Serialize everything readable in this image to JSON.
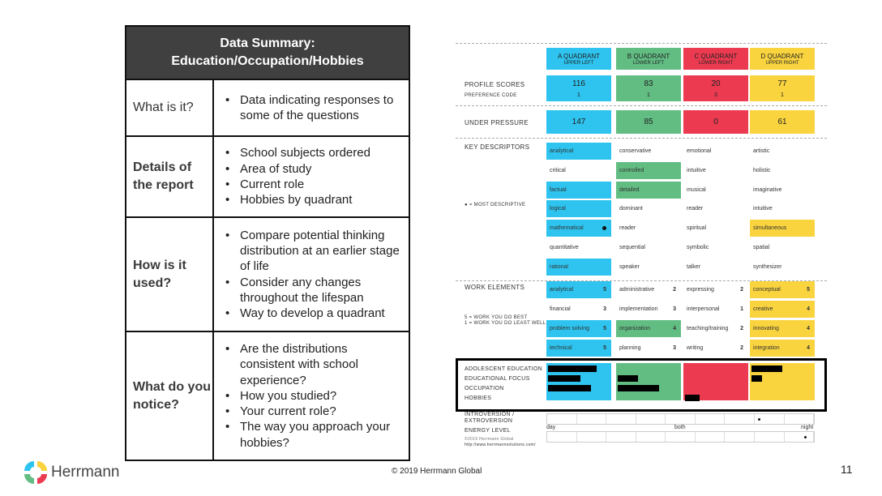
{
  "summary": {
    "title_line1": "Data Summary:",
    "title_line2": "Education/Occupation/Hobbies",
    "rows": [
      {
        "label": "What is it?",
        "bullets": [
          "Data indicating responses to some of the questions"
        ]
      },
      {
        "label": "Details of the report",
        "bullets": [
          "School subjects ordered",
          "Area of study",
          "Current role",
          "Hobbies by quadrant"
        ]
      },
      {
        "label": "How is it used?",
        "bullets": [
          "Compare potential  thinking distribution at an earlier stage of life",
          "Consider any changes throughout the lifespan",
          "Way to develop a quadrant"
        ]
      },
      {
        "label": "What do you notice?",
        "bullets": [
          "Are the distributions consistent with school experience?",
          "How you studied?",
          "Your current role?",
          "The way you approach your hobbies?"
        ]
      }
    ]
  },
  "report": {
    "colors": {
      "a": "#2ec4ef",
      "b": "#62bd83",
      "c": "#ec3a50",
      "d": "#fad43f"
    },
    "quadrants": [
      {
        "title": "A QUADRANT",
        "sub": "UPPER LEFT",
        "profile": "116",
        "code": "1",
        "pressure": "147"
      },
      {
        "title": "B QUADRANT",
        "sub": "LOWER LEFT",
        "profile": "83",
        "code": "1",
        "pressure": "85"
      },
      {
        "title": "C QUADRANT",
        "sub": "LOWER RIGHT",
        "profile": "20",
        "code": "3",
        "pressure": "0"
      },
      {
        "title": "D QUADRANT",
        "sub": "UPPER RIGHT",
        "profile": "77",
        "code": "1",
        "pressure": "61"
      }
    ],
    "labels": {
      "profile_scores": "PROFILE SCORES",
      "preference_code": "PREFERENCE CODE",
      "under_pressure": "UNDER PRESSURE",
      "key_descriptors": "KEY DESCRIPTORS",
      "most_descriptive": "● = MOST DESCRIPTIVE",
      "work_elements": "WORK ELEMENTS",
      "work_legend_1": "5 = WORK YOU DO BEST",
      "work_legend_2": "1 = WORK YOU DO LEAST WELL",
      "adolescent_education": "ADOLESCENT EDUCATION",
      "educational_focus": "EDUCATIONAL FOCUS",
      "occupation": "OCCUPATION",
      "hobbies": "HOBBIES",
      "introversion": "INTROVERSION /",
      "extroversion": "EXTROVERSION",
      "energy_level": "ENERGY LEVEL",
      "report_copyright": "©2019 Herrmann Global",
      "report_url": "http://www.herrmannsolutions.com/"
    },
    "descriptors": [
      [
        {
          "t": "analytical",
          "q": "a"
        },
        {
          "t": "conservative",
          "q": ""
        },
        {
          "t": "emotional",
          "q": ""
        },
        {
          "t": "artistic",
          "q": ""
        }
      ],
      [
        {
          "t": "critical",
          "q": ""
        },
        {
          "t": "controlled",
          "q": "b"
        },
        {
          "t": "intuitive",
          "q": ""
        },
        {
          "t": "holistic",
          "q": ""
        }
      ],
      [
        {
          "t": "factual",
          "q": "a"
        },
        {
          "t": "detailed",
          "q": "b"
        },
        {
          "t": "musical",
          "q": ""
        },
        {
          "t": "imaginative",
          "q": ""
        }
      ],
      [
        {
          "t": "logical",
          "q": "a"
        },
        {
          "t": "dominant",
          "q": ""
        },
        {
          "t": "reader",
          "q": ""
        },
        {
          "t": "intuitive",
          "q": ""
        }
      ],
      [
        {
          "t": "mathematical",
          "q": "a",
          "dot": true
        },
        {
          "t": "reader",
          "q": ""
        },
        {
          "t": "spiritual",
          "q": ""
        },
        {
          "t": "simultaneous",
          "q": "d"
        }
      ],
      [
        {
          "t": "quantitative",
          "q": ""
        },
        {
          "t": "sequential",
          "q": ""
        },
        {
          "t": "symbolic",
          "q": ""
        },
        {
          "t": "spatial",
          "q": ""
        }
      ],
      [
        {
          "t": "rational",
          "q": "a"
        },
        {
          "t": "speaker",
          "q": ""
        },
        {
          "t": "talker",
          "q": ""
        },
        {
          "t": "synthesizer",
          "q": ""
        }
      ]
    ],
    "work_elements": [
      [
        {
          "t": "analytical",
          "s": "5",
          "q": "a"
        },
        {
          "t": "administrative",
          "s": "2",
          "q": ""
        },
        {
          "t": "expressing",
          "s": "2",
          "q": ""
        },
        {
          "t": "conceptual",
          "s": "5",
          "q": "d"
        }
      ],
      [
        {
          "t": "financial",
          "s": "3",
          "q": ""
        },
        {
          "t": "implementation",
          "s": "3",
          "q": ""
        },
        {
          "t": "interpersonal",
          "s": "1",
          "q": ""
        },
        {
          "t": "creative",
          "s": "4",
          "q": "d"
        }
      ],
      [
        {
          "t": "problem solving",
          "s": "5",
          "q": "a"
        },
        {
          "t": "organization",
          "s": "4",
          "q": "b"
        },
        {
          "t": "teaching/training",
          "s": "2",
          "q": ""
        },
        {
          "t": "innovating",
          "s": "4",
          "q": "d"
        }
      ],
      [
        {
          "t": "technical",
          "s": "5",
          "q": "a"
        },
        {
          "t": "planning",
          "s": "3",
          "q": ""
        },
        {
          "t": "writing",
          "s": "2",
          "q": ""
        },
        {
          "t": "integration",
          "s": "4",
          "q": "d"
        }
      ]
    ],
    "energy_words": {
      "day": "day",
      "both": "both",
      "night": "night"
    },
    "introversion_mark_fraction": 0.79,
    "energy_mark_fraction": 0.96
  },
  "footer": {
    "logo_text": "Herrmann",
    "copyright": "© 2019 Herrmann Global",
    "page_number": "11"
  }
}
